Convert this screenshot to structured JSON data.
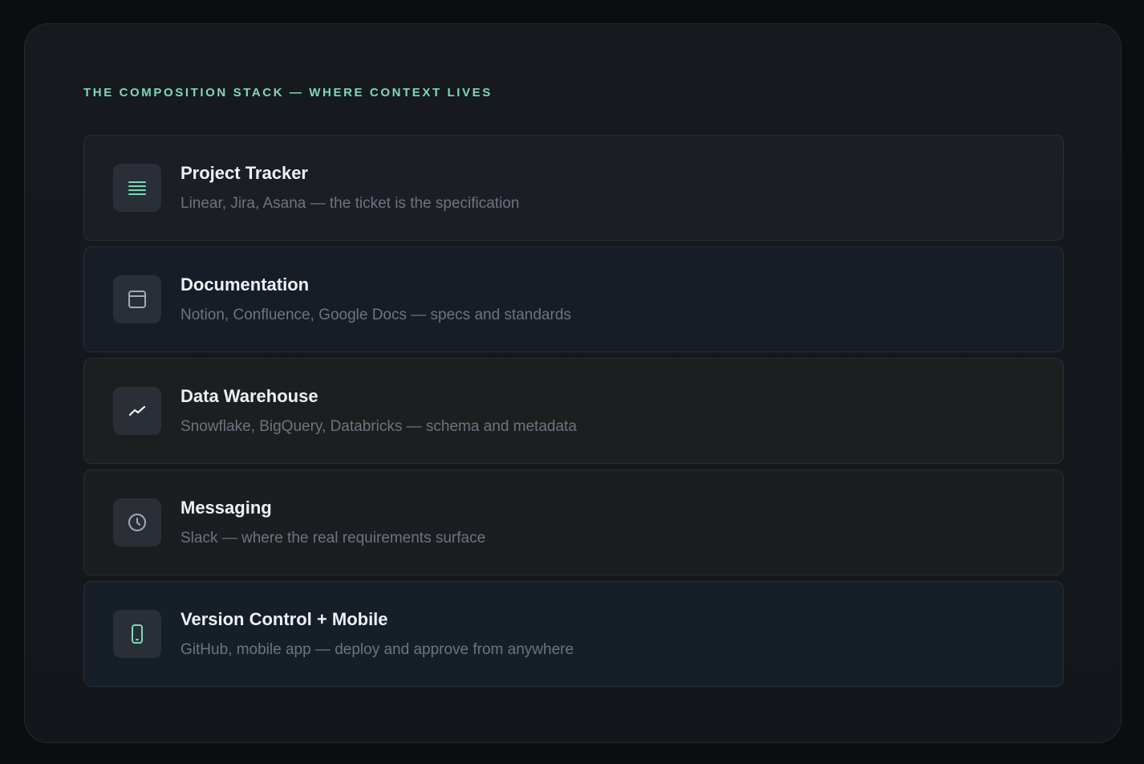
{
  "section": {
    "eyebrow": "THE COMPOSITION STACK — WHERE CONTEXT LIVES"
  },
  "colors": {
    "accent": "#7fd8b8",
    "muted_icon": "#a4abb6"
  },
  "stack": [
    {
      "title": "Project Tracker",
      "description": "Linear, Jira, Asana — the ticket is the specification",
      "icon": "menu-lines-icon"
    },
    {
      "title": "Documentation",
      "description": "Notion, Confluence, Google Docs — specs and standards",
      "icon": "browser-window-icon"
    },
    {
      "title": "Data Warehouse",
      "description": "Snowflake, BigQuery, Databricks — schema and metadata",
      "icon": "trend-line-icon"
    },
    {
      "title": "Messaging",
      "description": "Slack — where the real requirements surface",
      "icon": "clock-icon"
    },
    {
      "title": "Version Control + Mobile",
      "description": "GitHub, mobile app — deploy and approve from anywhere",
      "icon": "mobile-phone-icon"
    }
  ]
}
